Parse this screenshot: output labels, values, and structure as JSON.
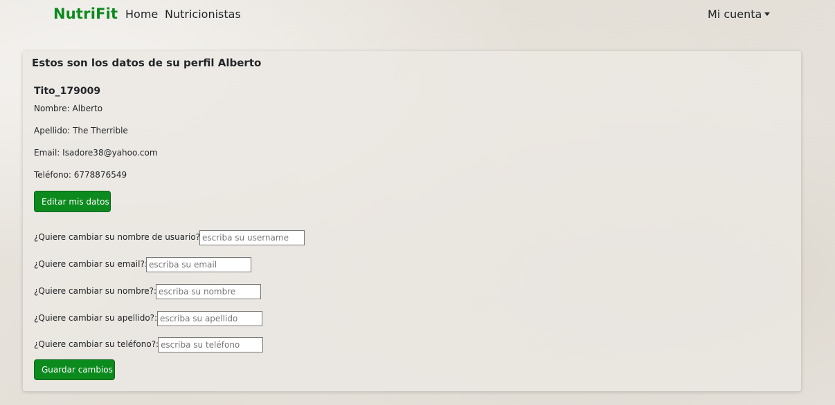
{
  "navbar": {
    "brand": "NutriFit",
    "links": [
      "Home",
      "Nutricionistas"
    ],
    "account_label": "Mi cuenta"
  },
  "profile": {
    "title": "Estos son los datos de su perfil Alberto",
    "username": "Tito_179009",
    "nombre": "Nombre: Alberto",
    "apellido": "Apellido: The Therrible",
    "email": "Email: Isadore38@yahoo.com",
    "telefono": "Teléfono: 6778876549",
    "edit_button": "Editar mis datos"
  },
  "form": {
    "fields": [
      {
        "label": "¿Quiere cambiar su nombre de usuario?:",
        "placeholder": "escriba su username"
      },
      {
        "label": "¿Quiere cambiar su email?:",
        "placeholder": "escriba su email"
      },
      {
        "label": "¿Quiere cambiar su nombre?:",
        "placeholder": "escriba su nombre"
      },
      {
        "label": "¿Quiere cambiar su apellido?:",
        "placeholder": "escriba su apellido"
      },
      {
        "label": "¿Quiere cambiar su teléfono?:",
        "placeholder": "escriba su teléfono"
      }
    ],
    "save_button": "Guardar cambios"
  },
  "colors": {
    "brand_green": "#0c8a1e",
    "button_green": "#0c8a1e",
    "text": "#212529"
  },
  "icons": {
    "account_dropdown": "caret-down-icon"
  }
}
